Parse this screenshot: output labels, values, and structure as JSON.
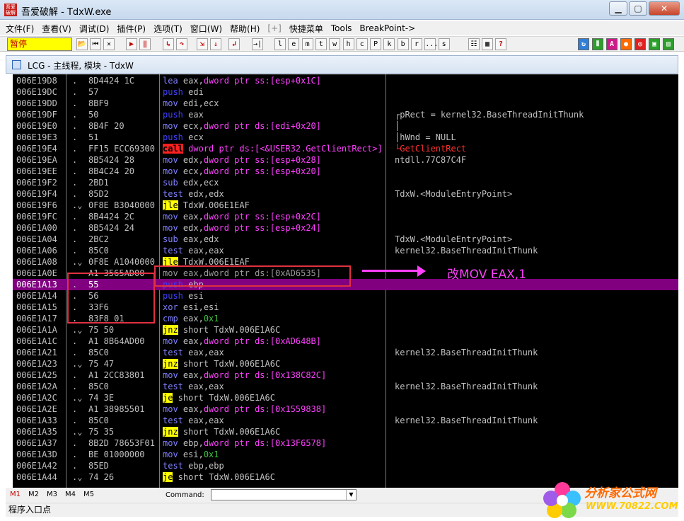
{
  "window": {
    "title": "吾爱破解 - TdxW.exe",
    "icon_text": "吾爱破解"
  },
  "menu": [
    "文件(F)",
    "查看(V)",
    "调试(D)",
    "插件(P)",
    "选项(T)",
    "窗口(W)",
    "帮助(H)",
    "[+]",
    "快捷菜单",
    "Tools",
    "BreakPoint->"
  ],
  "toolbar": {
    "status": "暂停",
    "letter_buttons": [
      "l",
      "e",
      "m",
      "t",
      "w",
      "h",
      "c",
      "P",
      "k",
      "b",
      "r",
      "...",
      "s"
    ]
  },
  "cpu_window": {
    "title": "LCG - 主线程, 模块 - TdxW"
  },
  "rows": [
    {
      "addr": "006E19D8",
      "mark": ".",
      "hex": "8D4424 1C",
      "asm": [
        [
          "mn",
          "lea"
        ],
        [
          "plain",
          " "
        ],
        [
          "op-reg",
          "eax,"
        ],
        [
          "op-mem",
          "dword ptr ss:[esp+0x1C]"
        ]
      ],
      "cmt": ""
    },
    {
      "addr": "006E19DC",
      "mark": ".",
      "hex": "57",
      "asm": [
        [
          "mn-push",
          "push"
        ],
        [
          "plain",
          " "
        ],
        [
          "op-reg",
          "edi"
        ]
      ],
      "cmt": ""
    },
    {
      "addr": "006E19DD",
      "mark": ".",
      "hex": "8BF9",
      "asm": [
        [
          "mn",
          "mov"
        ],
        [
          "plain",
          " "
        ],
        [
          "op-reg",
          "edi,ecx"
        ]
      ],
      "cmt": ""
    },
    {
      "addr": "006E19DF",
      "mark": ".",
      "hex": "50",
      "asm": [
        [
          "mn-push",
          "push"
        ],
        [
          "plain",
          " "
        ],
        [
          "op-reg",
          "eax"
        ]
      ],
      "cmt": "┌pRect = kernel32.BaseThreadInitThunk"
    },
    {
      "addr": "006E19E0",
      "mark": ".",
      "hex": "8B4F 20",
      "asm": [
        [
          "mn",
          "mov"
        ],
        [
          "plain",
          " "
        ],
        [
          "op-reg",
          "ecx,"
        ],
        [
          "op-mem",
          "dword ptr ds:[edi+0x20]"
        ]
      ],
      "cmt": "│"
    },
    {
      "addr": "006E19E3",
      "mark": ".",
      "hex": "51",
      "asm": [
        [
          "mn-push",
          "push"
        ],
        [
          "plain",
          " "
        ],
        [
          "op-reg",
          "ecx"
        ]
      ],
      "cmt": "│hWnd = NULL"
    },
    {
      "addr": "006E19E4",
      "mark": ".",
      "hex": "FF15 ECC69300",
      "asm": [
        [
          "mn-call",
          "call"
        ],
        [
          "plain",
          " "
        ],
        [
          "op-mem",
          "dword ptr ds:[<&USER32.GetClientRect>]"
        ]
      ],
      "cmt": "└GetClientRect",
      "cmt_red": true
    },
    {
      "addr": "006E19EA",
      "mark": ".",
      "hex": "8B5424 28",
      "asm": [
        [
          "mn",
          "mov"
        ],
        [
          "plain",
          " "
        ],
        [
          "op-reg",
          "edx,"
        ],
        [
          "op-mem",
          "dword ptr ss:[esp+0x28]"
        ]
      ],
      "cmt": "ntdll.77C87C4F"
    },
    {
      "addr": "006E19EE",
      "mark": ".",
      "hex": "8B4C24 20",
      "asm": [
        [
          "mn",
          "mov"
        ],
        [
          "plain",
          " "
        ],
        [
          "op-reg",
          "ecx,"
        ],
        [
          "op-mem",
          "dword ptr ss:[esp+0x20]"
        ]
      ],
      "cmt": ""
    },
    {
      "addr": "006E19F2",
      "mark": ".",
      "hex": "2BD1",
      "asm": [
        [
          "mn",
          "sub"
        ],
        [
          "plain",
          " "
        ],
        [
          "op-reg",
          "edx,ecx"
        ]
      ],
      "cmt": ""
    },
    {
      "addr": "006E19F4",
      "mark": ".",
      "hex": "85D2",
      "asm": [
        [
          "mn",
          "test"
        ],
        [
          "plain",
          " "
        ],
        [
          "op-reg",
          "edx,edx"
        ]
      ],
      "cmt": "TdxW.<ModuleEntryPoint>"
    },
    {
      "addr": "006E19F6",
      "mark": ".⌄",
      "hex": "0F8E B3040000",
      "asm": [
        [
          "mn-jmp",
          "jle"
        ],
        [
          "plain",
          " TdxW.006E1EAF"
        ]
      ],
      "cmt": ""
    },
    {
      "addr": "006E19FC",
      "mark": ".",
      "hex": "8B4424 2C",
      "asm": [
        [
          "mn",
          "mov"
        ],
        [
          "plain",
          " "
        ],
        [
          "op-reg",
          "eax,"
        ],
        [
          "op-mem",
          "dword ptr ss:[esp+0x2C]"
        ]
      ],
      "cmt": ""
    },
    {
      "addr": "006E1A00",
      "mark": ".",
      "hex": "8B5424 24",
      "asm": [
        [
          "mn",
          "mov"
        ],
        [
          "plain",
          " "
        ],
        [
          "op-reg",
          "edx,"
        ],
        [
          "op-mem",
          "dword ptr ss:[esp+0x24]"
        ]
      ],
      "cmt": ""
    },
    {
      "addr": "006E1A04",
      "mark": ".",
      "hex": "2BC2",
      "asm": [
        [
          "mn",
          "sub"
        ],
        [
          "plain",
          " "
        ],
        [
          "op-reg",
          "eax,edx"
        ]
      ],
      "cmt": "TdxW.<ModuleEntryPoint>"
    },
    {
      "addr": "006E1A06",
      "mark": ".",
      "hex": "85C0",
      "asm": [
        [
          "mn",
          "test"
        ],
        [
          "plain",
          " "
        ],
        [
          "op-reg",
          "eax,eax"
        ]
      ],
      "cmt": "kernel32.BaseThreadInitThunk"
    },
    {
      "addr": "006E1A08",
      "mark": ".⌄",
      "hex": "0F8E A1040000",
      "asm": [
        [
          "mn-jmp",
          "jle"
        ],
        [
          "plain",
          " TdxW.006E1EAF"
        ]
      ],
      "cmt": ""
    },
    {
      "addr": "006E1A0E",
      "mark": "",
      "hex": "A1 3565AD00",
      "asm": [
        [
          "mn",
          "mov"
        ],
        [
          "plain",
          " "
        ],
        [
          "op-reg",
          "eax,"
        ],
        [
          "op-mem",
          "dword ptr ds:[0xAD6535]"
        ]
      ],
      "cmt": "",
      "dim": true
    },
    {
      "addr": "006E1A13",
      "mark": ".",
      "hex": "55",
      "asm": [
        [
          "mn-push",
          "push"
        ],
        [
          "plain",
          " "
        ],
        [
          "op-reg",
          "ebp"
        ]
      ],
      "cmt": "",
      "sel": true
    },
    {
      "addr": "006E1A14",
      "mark": ".",
      "hex": "56",
      "asm": [
        [
          "mn-push",
          "push"
        ],
        [
          "plain",
          " "
        ],
        [
          "op-reg",
          "esi"
        ]
      ],
      "cmt": ""
    },
    {
      "addr": "006E1A15",
      "mark": ".",
      "hex": "33F6",
      "asm": [
        [
          "mn",
          "xor"
        ],
        [
          "plain",
          " "
        ],
        [
          "op-reg",
          "esi,esi"
        ]
      ],
      "cmt": ""
    },
    {
      "addr": "006E1A17",
      "mark": ".",
      "hex": "83F8 01",
      "asm": [
        [
          "mn",
          "cmp"
        ],
        [
          "plain",
          " "
        ],
        [
          "op-reg",
          "eax,"
        ],
        [
          "op-imm",
          "0x1"
        ]
      ],
      "cmt": ""
    },
    {
      "addr": "006E1A1A",
      "mark": ".⌄",
      "hex": "75 50",
      "asm": [
        [
          "mn-jmp",
          "jnz"
        ],
        [
          "plain",
          " short TdxW.006E1A6C"
        ]
      ],
      "cmt": ""
    },
    {
      "addr": "006E1A1C",
      "mark": ".",
      "hex": "A1 8B64AD00",
      "asm": [
        [
          "mn",
          "mov"
        ],
        [
          "plain",
          " "
        ],
        [
          "op-reg",
          "eax,"
        ],
        [
          "op-mem",
          "dword ptr ds:[0xAD648B]"
        ]
      ],
      "cmt": ""
    },
    {
      "addr": "006E1A21",
      "mark": ".",
      "hex": "85C0",
      "asm": [
        [
          "mn",
          "test"
        ],
        [
          "plain",
          " "
        ],
        [
          "op-reg",
          "eax,eax"
        ]
      ],
      "cmt": "kernel32.BaseThreadInitThunk"
    },
    {
      "addr": "006E1A23",
      "mark": ".⌄",
      "hex": "75 47",
      "asm": [
        [
          "mn-jmp",
          "jnz"
        ],
        [
          "plain",
          " short TdxW.006E1A6C"
        ]
      ],
      "cmt": ""
    },
    {
      "addr": "006E1A25",
      "mark": ".",
      "hex": "A1 2CC83801",
      "asm": [
        [
          "mn",
          "mov"
        ],
        [
          "plain",
          " "
        ],
        [
          "op-reg",
          "eax,"
        ],
        [
          "op-mem",
          "dword ptr ds:[0x138C82C]"
        ]
      ],
      "cmt": ""
    },
    {
      "addr": "006E1A2A",
      "mark": ".",
      "hex": "85C0",
      "asm": [
        [
          "mn",
          "test"
        ],
        [
          "plain",
          " "
        ],
        [
          "op-reg",
          "eax,eax"
        ]
      ],
      "cmt": "kernel32.BaseThreadInitThunk"
    },
    {
      "addr": "006E1A2C",
      "mark": ".⌄",
      "hex": "74 3E",
      "asm": [
        [
          "mn-jmp",
          "je"
        ],
        [
          "plain",
          " short TdxW.006E1A6C"
        ]
      ],
      "cmt": ""
    },
    {
      "addr": "006E1A2E",
      "mark": ".",
      "hex": "A1 38985501",
      "asm": [
        [
          "mn",
          "mov"
        ],
        [
          "plain",
          " "
        ],
        [
          "op-reg",
          "eax,"
        ],
        [
          "op-mem",
          "dword ptr ds:[0x1559838]"
        ]
      ],
      "cmt": ""
    },
    {
      "addr": "006E1A33",
      "mark": ".",
      "hex": "85C0",
      "asm": [
        [
          "mn",
          "test"
        ],
        [
          "plain",
          " "
        ],
        [
          "op-reg",
          "eax,eax"
        ]
      ],
      "cmt": "kernel32.BaseThreadInitThunk"
    },
    {
      "addr": "006E1A35",
      "mark": ".⌄",
      "hex": "75 35",
      "asm": [
        [
          "mn-jmp",
          "jnz"
        ],
        [
          "plain",
          " short TdxW.006E1A6C"
        ]
      ],
      "cmt": ""
    },
    {
      "addr": "006E1A37",
      "mark": ".",
      "hex": "8B2D 78653F01",
      "asm": [
        [
          "mn",
          "mov"
        ],
        [
          "plain",
          " "
        ],
        [
          "op-reg",
          "ebp,"
        ],
        [
          "op-mem",
          "dword ptr ds:[0x13F6578]"
        ]
      ],
      "cmt": ""
    },
    {
      "addr": "006E1A3D",
      "mark": ".",
      "hex": "BE 01000000",
      "asm": [
        [
          "mn",
          "mov"
        ],
        [
          "plain",
          " "
        ],
        [
          "op-reg",
          "esi,"
        ],
        [
          "op-imm",
          "0x1"
        ]
      ],
      "cmt": ""
    },
    {
      "addr": "006E1A42",
      "mark": ".",
      "hex": "85ED",
      "asm": [
        [
          "mn",
          "test"
        ],
        [
          "plain",
          " "
        ],
        [
          "op-reg",
          "ebp,ebp"
        ]
      ],
      "cmt": ""
    },
    {
      "addr": "006E1A44",
      "mark": ".⌄",
      "hex": "74 26",
      "asm": [
        [
          "mn-jmp",
          "je"
        ],
        [
          "plain",
          " short TdxW.006E1A6C"
        ]
      ],
      "cmt": ""
    }
  ],
  "annotation": {
    "text": "改MOV EAX,1",
    "color": "#ff40ff",
    "box_color": "#e03040"
  },
  "bottom": {
    "tabs": [
      "M1",
      "M2",
      "M3",
      "M4",
      "M5"
    ],
    "command_label": "Command:",
    "status": "程序入口点"
  },
  "watermark": {
    "line1": "分析家公式网",
    "line2": "WWW.70822.COM"
  },
  "colors": {
    "selection": "#800080",
    "background": "#000000",
    "status_yellow": "#ffff00"
  }
}
